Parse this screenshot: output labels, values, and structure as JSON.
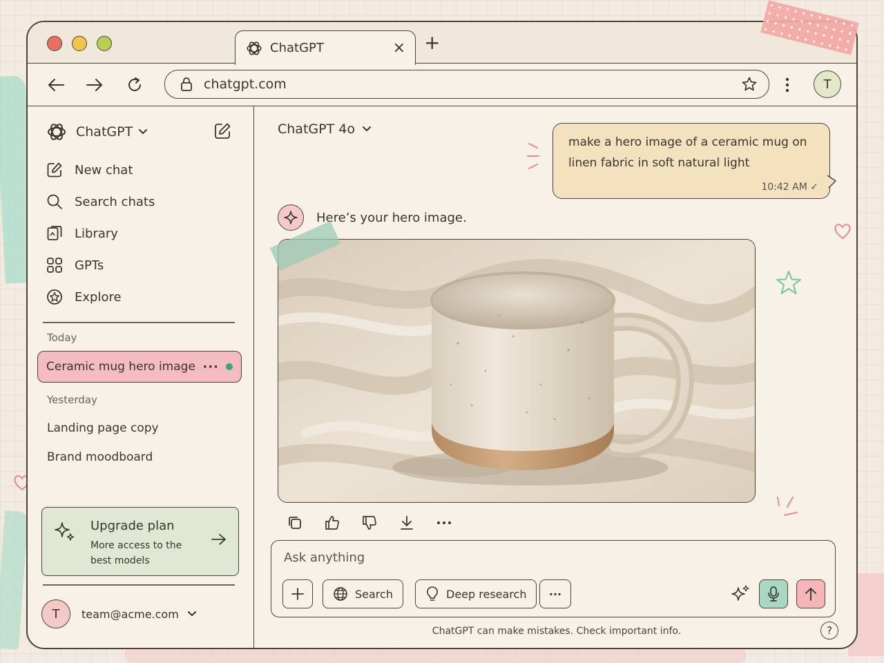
{
  "browser": {
    "tab_title": "ChatGPT",
    "tab_close": "×",
    "new_tab": "+",
    "url": "chatgpt.com",
    "profile_initial": "T"
  },
  "sidebar": {
    "brand": "ChatGPT",
    "items": [
      {
        "label": "New chat",
        "icon": "new-chat-icon"
      },
      {
        "label": "Search chats",
        "icon": "search-icon"
      },
      {
        "label": "Library",
        "icon": "library-icon"
      },
      {
        "label": "GPTs",
        "icon": "gpts-grid-icon"
      },
      {
        "label": "Explore",
        "icon": "explore-icon"
      }
    ],
    "today_label": "Today",
    "active_chat": "Ceramic mug hero image",
    "active_chat_more": "···",
    "yesterday_label": "Yesterday",
    "yesterday_chats": [
      "Landing page copy",
      "Brand moodboard"
    ],
    "upgrade": {
      "title": "Upgrade plan",
      "subtitle": "More access to the best models"
    },
    "account": {
      "initial": "T",
      "email": "team@acme.com"
    }
  },
  "main": {
    "model": "ChatGPT 4o",
    "user_message": "make a hero image of a ceramic mug on linen fabric in soft natural light",
    "user_message_time": "10:42 AM",
    "assistant_message": "Here’s your hero image.",
    "composer": {
      "placeholder": "Ask anything",
      "search_label": "Search",
      "deep_research_label": "Deep research",
      "more_label": "···"
    },
    "disclaimer": "ChatGPT can make mistakes. Check important info.",
    "help_label": "?"
  },
  "colors": {
    "accent_pink": "#f4bcc0",
    "accent_mint": "#a9d8c2",
    "user_bubble": "#f4e1bd",
    "status_green": "#3aa57f"
  }
}
